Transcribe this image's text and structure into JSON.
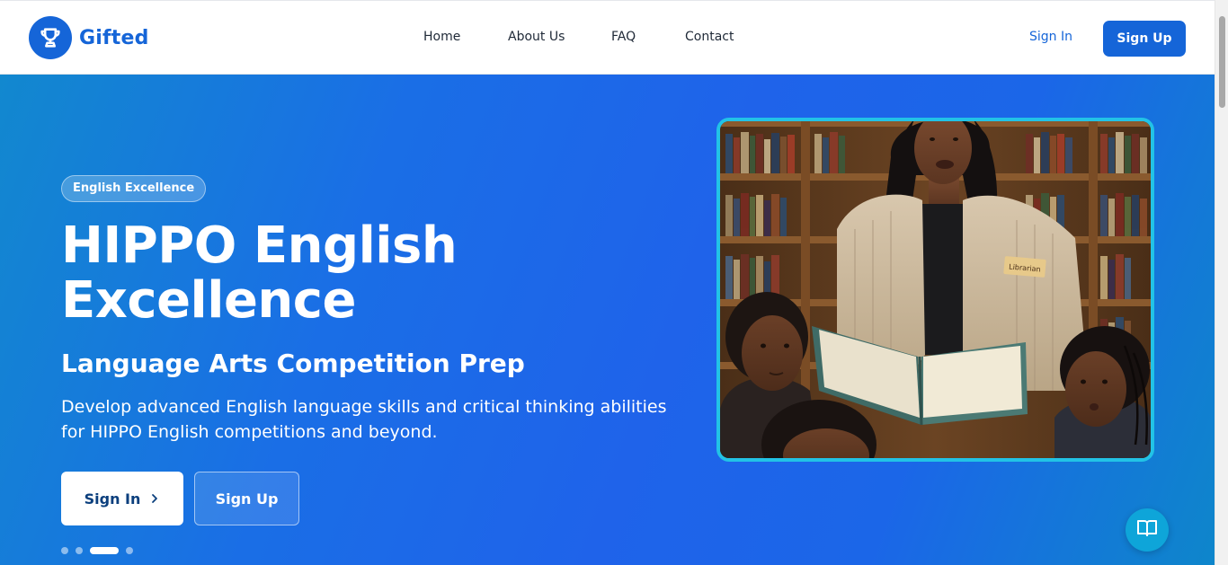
{
  "brand": {
    "name": "Gifted",
    "logo_icon": "trophy-icon",
    "color": "#1565d8"
  },
  "nav": {
    "links": [
      "Home",
      "About Us",
      "FAQ",
      "Contact"
    ],
    "sign_in": "Sign In",
    "sign_up": "Sign Up"
  },
  "hero": {
    "badge": "English Excellence",
    "title_line1": "HIPPO English",
    "title_line2": "Excellence",
    "subtitle": "Language Arts Competition Prep",
    "description": "Develop advanced English language skills and critical thinking abilities for HIPPO English competitions and beyond.",
    "primary_button": "Sign In",
    "secondary_button": "Sign Up",
    "carousel": {
      "slides": 4,
      "active_index": 2
    },
    "image_name_tag": "Librarian",
    "image_subject": "librarian reading a book to children"
  },
  "fab": {
    "icon": "book-open-icon"
  },
  "colors": {
    "accent": "#1565d8",
    "hero_start": "#1288cf",
    "hero_mid": "#1f63ea",
    "image_border": "#22c3e6",
    "fab": "#0ea5d9"
  }
}
